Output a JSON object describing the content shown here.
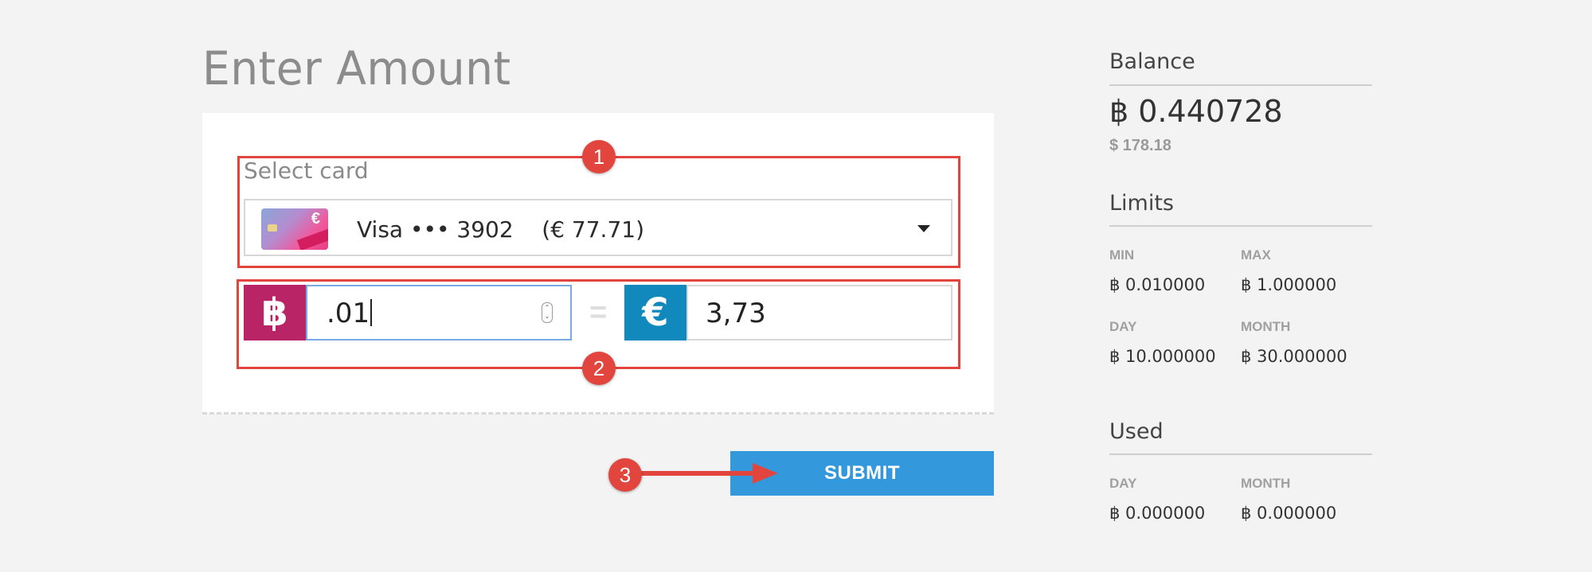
{
  "form": {
    "title": "Enter Amount",
    "select_card_label": "Select card",
    "selected_card_text": "Visa ••• 3902    (€ 77.71)",
    "btc_symbol": "฿",
    "eur_symbol": "€",
    "amount_value": ".01",
    "equals": "=",
    "converted_value": "3,73",
    "submit_label": "SUBMIT"
  },
  "annotations": [
    "1",
    "2",
    "3"
  ],
  "sidebar": {
    "balance": {
      "heading": "Balance",
      "value": "฿ 0.440728",
      "usd": "$ 178.18"
    },
    "limits": {
      "heading": "Limits",
      "items": [
        {
          "label": "MIN",
          "value": "฿ 0.010000"
        },
        {
          "label": "MAX",
          "value": "฿ 1.000000"
        },
        {
          "label": "DAY",
          "value": "฿ 10.000000"
        },
        {
          "label": "MONTH",
          "value": "฿ 30.000000"
        }
      ]
    },
    "used": {
      "heading": "Used",
      "items": [
        {
          "label": "DAY",
          "value": "฿ 0.000000"
        },
        {
          "label": "MONTH",
          "value": "฿ 0.000000"
        }
      ]
    }
  },
  "colors": {
    "annotation_red": "#e1453d",
    "btc_magenta": "#b92467",
    "eur_blue": "#1289bd",
    "submit_blue": "#3498dc"
  },
  "icons": {
    "card_thumbnail": "credit-card-icon",
    "dropdown": "caret-down-icon",
    "stepper": "number-stepper-icon",
    "arrow": "arrow-right-icon"
  }
}
